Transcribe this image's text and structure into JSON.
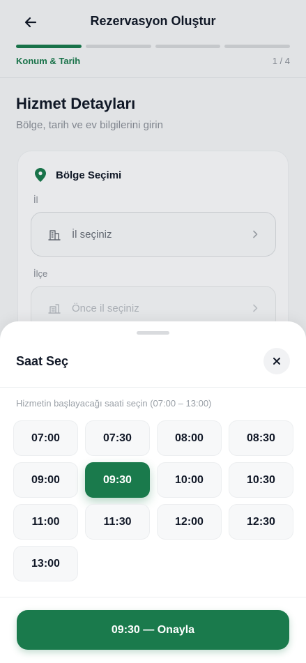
{
  "header": {
    "title": "Rezervasyon Oluştur",
    "step_label": "Konum & Tarih",
    "step_count": "1 / 4",
    "progress": {
      "current_step": 1,
      "total_steps": 4
    }
  },
  "section": {
    "title": "Hizmet Detayları",
    "subtitle": "Bölge, tarih ve ev bilgilerini girin"
  },
  "region_card": {
    "title": "Bölge Seçimi",
    "province": {
      "label": "İl",
      "placeholder": "İl seçiniz"
    },
    "district": {
      "label": "İlçe",
      "placeholder": "Önce il seçiniz"
    }
  },
  "sheet": {
    "title": "Saat Seç",
    "hint": "Hizmetin başlayacağı saati seçin (07:00 – 13:00)",
    "slots": [
      "07:00",
      "07:30",
      "08:00",
      "08:30",
      "09:00",
      "09:30",
      "10:00",
      "10:30",
      "11:00",
      "11:30",
      "12:00",
      "12:30",
      "13:00"
    ],
    "selected": "09:30",
    "confirm_label": "09:30 — Onayla"
  },
  "colors": {
    "accent": "#1a7a4c",
    "text": "#111827",
    "muted": "#8a8f97"
  },
  "icons": {
    "back": "arrow-left-icon",
    "location": "map-pin-icon",
    "province": "building-icon",
    "district": "buildings-icon",
    "chevron": "chevron-right-icon",
    "close": "close-icon"
  }
}
